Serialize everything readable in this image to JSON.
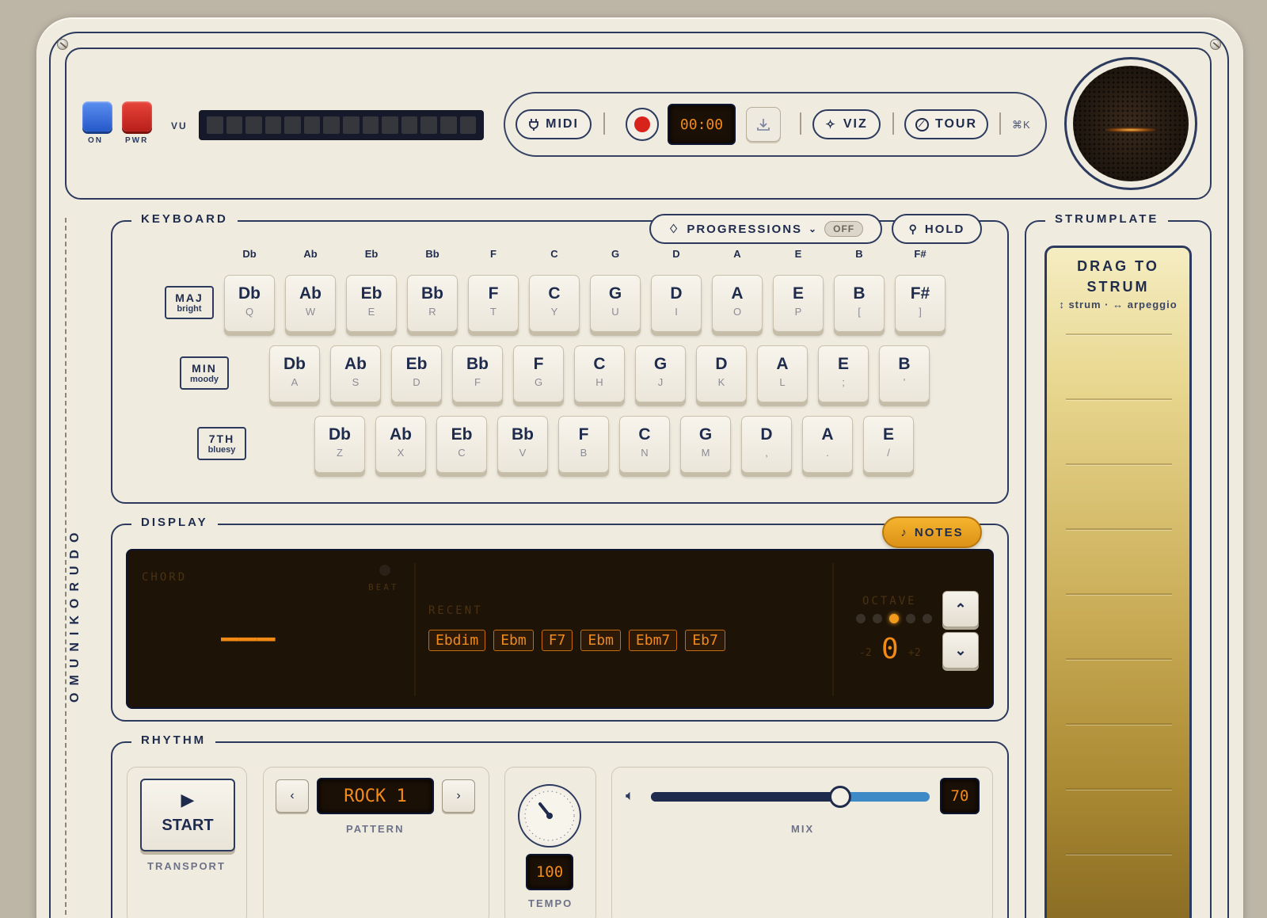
{
  "power": {
    "on_label": "ON",
    "pwr_label": "PWR",
    "vu_label": "VU",
    "vu_segments": 14
  },
  "toolbar": {
    "midi_label": "MIDI",
    "timer": "00:00",
    "viz_label": "VIZ",
    "tour_label": "TOUR",
    "shortcut": "⌘K"
  },
  "brand": "OMUNIKORUDO",
  "keyboard": {
    "title": "KEYBOARD",
    "progressions_label": "PROGRESSIONS",
    "progressions_state": "OFF",
    "hold_label": "HOLD",
    "columns": [
      "Db",
      "Ab",
      "Eb",
      "Bb",
      "F",
      "C",
      "G",
      "D",
      "A",
      "E",
      "B",
      "F#"
    ],
    "rows": [
      {
        "label": "MAJ",
        "sub": "bright",
        "keys": [
          {
            "n": "Db",
            "s": "Q"
          },
          {
            "n": "Ab",
            "s": "W"
          },
          {
            "n": "Eb",
            "s": "E"
          },
          {
            "n": "Bb",
            "s": "R"
          },
          {
            "n": "F",
            "s": "T"
          },
          {
            "n": "C",
            "s": "Y"
          },
          {
            "n": "G",
            "s": "U"
          },
          {
            "n": "D",
            "s": "I"
          },
          {
            "n": "A",
            "s": "O"
          },
          {
            "n": "E",
            "s": "P"
          },
          {
            "n": "B",
            "s": "["
          },
          {
            "n": "F#",
            "s": "]"
          }
        ]
      },
      {
        "label": "MIN",
        "sub": "moody",
        "keys": [
          {
            "n": "Db",
            "s": "A"
          },
          {
            "n": "Ab",
            "s": "S"
          },
          {
            "n": "Eb",
            "s": "D"
          },
          {
            "n": "Bb",
            "s": "F"
          },
          {
            "n": "F",
            "s": "G"
          },
          {
            "n": "C",
            "s": "H"
          },
          {
            "n": "G",
            "s": "J"
          },
          {
            "n": "D",
            "s": "K"
          },
          {
            "n": "A",
            "s": "L"
          },
          {
            "n": "E",
            "s": ";"
          },
          {
            "n": "B",
            "s": "'"
          }
        ]
      },
      {
        "label": "7TH",
        "sub": "bluesy",
        "keys": [
          {
            "n": "Db",
            "s": "Z"
          },
          {
            "n": "Ab",
            "s": "X"
          },
          {
            "n": "Eb",
            "s": "C"
          },
          {
            "n": "Bb",
            "s": "V"
          },
          {
            "n": "F",
            "s": "B"
          },
          {
            "n": "C",
            "s": "N"
          },
          {
            "n": "G",
            "s": "M"
          },
          {
            "n": "D",
            "s": ","
          },
          {
            "n": "A",
            "s": "."
          },
          {
            "n": "E",
            "s": "/"
          }
        ]
      }
    ]
  },
  "display": {
    "title": "DISPLAY",
    "notes_label": "NOTES",
    "chord_label": "CHORD",
    "beat_label": "BEAT",
    "chord_value": "———",
    "recent_label": "RECENT",
    "recent": [
      "Ebdim",
      "Ebm",
      "F7",
      "Ebm",
      "Ebm7",
      "Eb7"
    ],
    "octave_label": "OCTAVE",
    "octave_value": "0",
    "octave_min": "-2",
    "octave_max": "+2",
    "octave_selected_index": 2
  },
  "strumplate": {
    "title": "STRUMPLATE",
    "heading": "DRAG TO STRUM",
    "hint": "↕ strum · ↔ arpeggio"
  },
  "rhythm": {
    "title": "RHYTHM",
    "start_label": "START",
    "transport_label": "TRANSPORT",
    "pattern_value": "ROCK 1",
    "pattern_label": "PATTERN",
    "tempo_value": "100",
    "tempo_label": "TEMPO",
    "mix_value": "70",
    "mix_label": "MIX",
    "mix_fraction": 0.68
  },
  "colors": {
    "accent": "#f08a1b",
    "navy": "#1f2b4d",
    "record": "#d8231d",
    "notes_button": "#e9a21f"
  }
}
